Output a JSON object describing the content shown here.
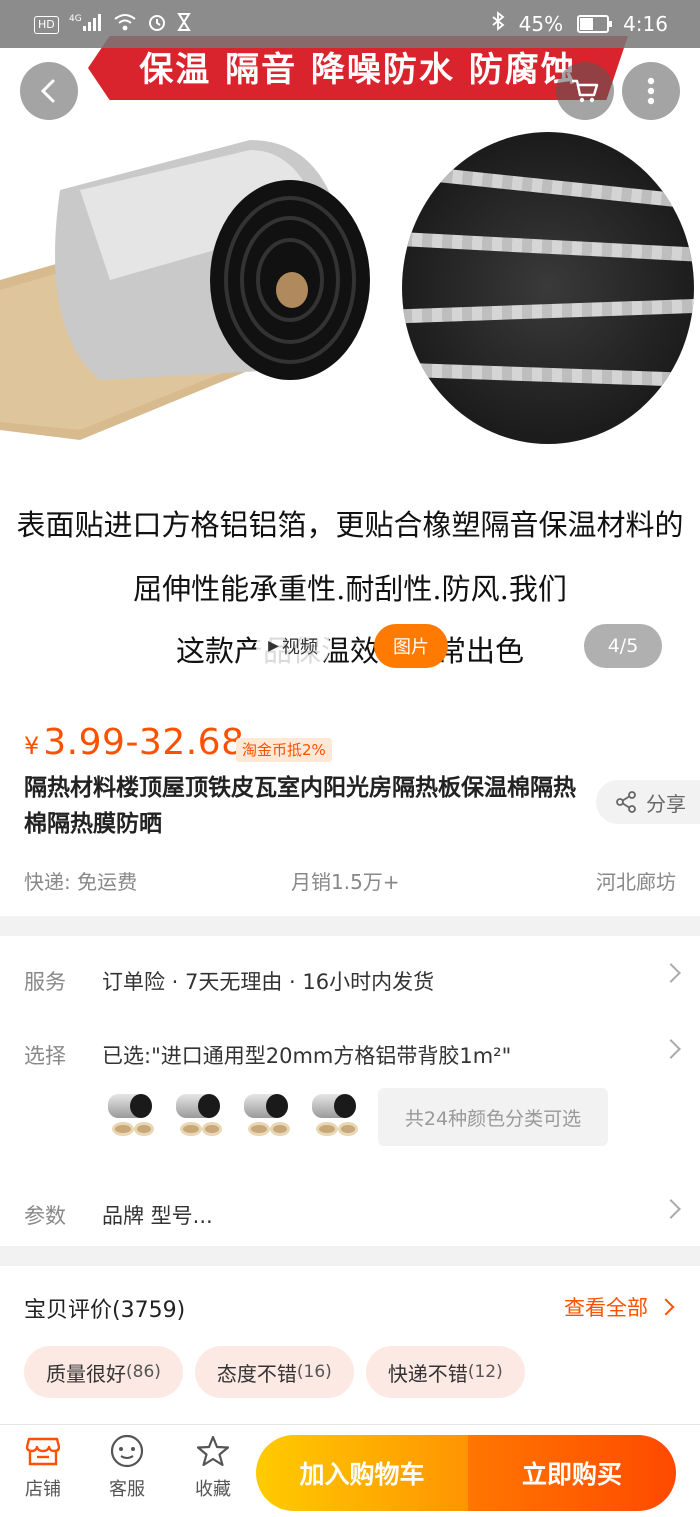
{
  "status_bar": {
    "signal_label": "4G",
    "hd_label": "HD",
    "battery": "45%",
    "battery_level": 0.45,
    "time": "4:16"
  },
  "hero": {
    "banner": "保温 隔音 降噪防水 防腐蚀",
    "caption_lines": [
      "表面贴进口方格铝铝箔，更贴合橡塑隔音保温材料的",
      "屈伸性能承重性.耐刮性.防风.我们",
      "这款产品保温效果非常出色"
    ],
    "tab_video": "视频",
    "tab_pictures": "图片",
    "page_indicator": "4/5"
  },
  "product": {
    "price_symbol": "¥",
    "price": "3.99-32.68",
    "coin_tag": "淘金币抵2%",
    "title": "隔热材料楼顶屋顶铁皮瓦室内阳光房隔热板保温棉隔热棉隔热膜防晒",
    "share_label": "分享",
    "shipping": "快递: 免运费",
    "monthly_sales": "月销1.5万+",
    "location": "河北廊坊"
  },
  "details": {
    "service_label": "服务",
    "service_value": "订单险 · 7天无理由 · 16小时内发货",
    "select_label": "选择",
    "select_value": "已选:\"进口通用型20mm方格铝带背胶1m²\"",
    "variants_badge": "共24种颜色分类可选",
    "params_label": "参数",
    "params_value": "品牌 型号..."
  },
  "reviews": {
    "title": "宝贝评价(3759)",
    "view_all": "查看全部",
    "tags": [
      {
        "label": "质量很好",
        "count": "(86)"
      },
      {
        "label": "态度不错",
        "count": "(16)"
      },
      {
        "label": "快递不错",
        "count": "(12)"
      }
    ]
  },
  "bottom_bar": {
    "store": "店铺",
    "service": "客服",
    "favorite": "收藏",
    "add_to_cart": "加入购物车",
    "buy_now": "立即购买"
  },
  "colors": {
    "accent": "#ff5000",
    "cart_gradient_start": "#ffcb00",
    "buy_gradient_end": "#ff4900",
    "banner_red": "#d9232d"
  }
}
